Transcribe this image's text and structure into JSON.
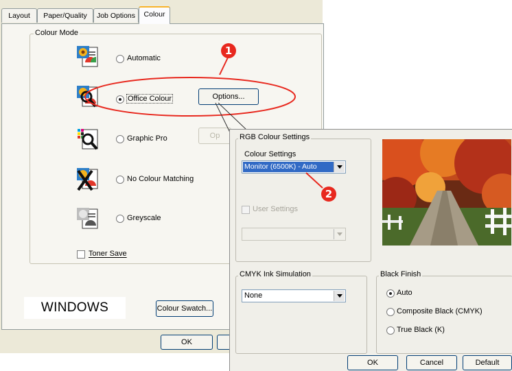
{
  "main_dialog": {
    "tabs": [
      {
        "label": "Layout"
      },
      {
        "label": "Paper/Quality"
      },
      {
        "label": "Job Options"
      },
      {
        "label": "Colour"
      }
    ],
    "colour_mode": {
      "title": "Colour Mode",
      "options": [
        {
          "label": "Automatic",
          "selected": false
        },
        {
          "label": "Office Colour",
          "selected": true
        },
        {
          "label": "Graphic Pro",
          "selected": false
        },
        {
          "label": "No Colour Matching",
          "selected": false
        },
        {
          "label": "Greyscale",
          "selected": false
        }
      ],
      "options_button": "Options...",
      "options_button_2": "Op"
    },
    "toner_save": "Toner Save",
    "colour_swatch_button": "Colour Swatch...",
    "ok_button": "OK",
    "windows_label": "WINDOWS"
  },
  "rgb_dialog": {
    "rgb_group_title": "RGB Colour Settings",
    "colour_settings_label": "Colour Settings",
    "colour_settings_value": "Monitor (6500K) - Auto",
    "user_settings_label": "User Settings",
    "user_settings_value": "",
    "cmyk_group_title": "CMYK Ink Simulation",
    "cmyk_value": "None",
    "black_finish": {
      "title": "Black Finish",
      "options": [
        {
          "label": "Auto",
          "selected": true
        },
        {
          "label": "Composite Black (CMYK)",
          "selected": false
        },
        {
          "label": "True Black (K)",
          "selected": false
        }
      ]
    },
    "ok_button": "OK",
    "cancel_button": "Cancel",
    "default_button": "Default"
  },
  "callouts": {
    "one": "1",
    "two": "2",
    "color": "#e8281e"
  }
}
